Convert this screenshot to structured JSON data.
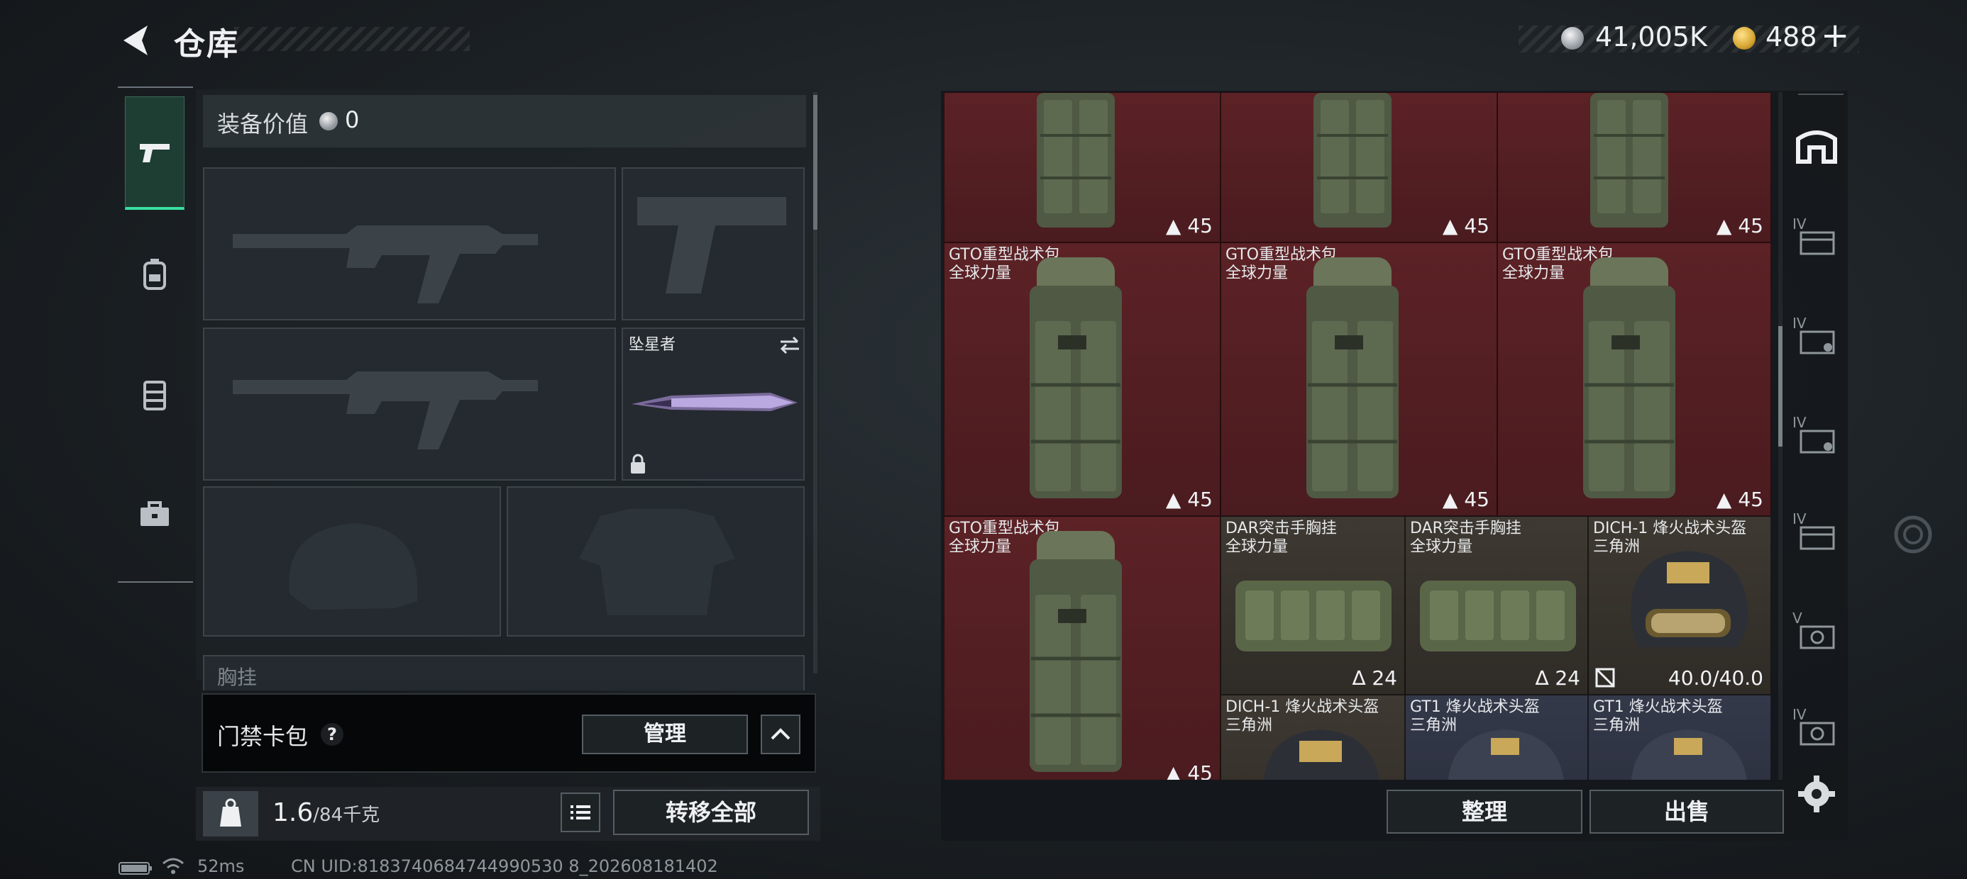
{
  "header": {
    "title": "仓库",
    "currency1": "41,005K",
    "currency2": "488",
    "plus_label": "+"
  },
  "equipment": {
    "value_label": "装备价值",
    "value": "0",
    "melee_name": "坠星者",
    "chest_label": "胸挂"
  },
  "card_bag": {
    "title": "门禁卡包",
    "help": "?",
    "manage_label": "管理"
  },
  "weight": {
    "current": "1.6",
    "max": "/84千克",
    "kg_icon_text": "KG",
    "transfer_label": "转移全部"
  },
  "status": {
    "ping": "52ms",
    "uid": "CN UID:8183740684744990530 8_202608181402"
  },
  "storage": {
    "items": [
      {
        "name": "",
        "sub": "",
        "count": "45",
        "count_icon": "bag-icon"
      },
      {
        "name": "",
        "sub": "",
        "count": "45",
        "count_icon": "bag-icon"
      },
      {
        "name": "",
        "sub": "",
        "count": "45",
        "count_icon": "bag-icon"
      },
      {
        "name": "GTO重型战术包",
        "sub": "全球力量",
        "count": "45",
        "count_icon": "bag-icon"
      },
      {
        "name": "GTO重型战术包",
        "sub": "全球力量",
        "count": "45",
        "count_icon": "bag-icon"
      },
      {
        "name": "GTO重型战术包",
        "sub": "全球力量",
        "count": "45",
        "count_icon": "bag-icon"
      },
      {
        "name": "GTO重型战术包",
        "sub": "全球力量",
        "count": "45",
        "count_icon": "bag-icon"
      },
      {
        "name": "DAR突击手胸挂",
        "sub": "全球力量",
        "count": "24",
        "count_icon": "vest-icon"
      },
      {
        "name": "DAR突击手胸挂",
        "sub": "全球力量",
        "count": "24",
        "count_icon": "vest-icon"
      },
      {
        "name": "DICH-1 烽火战术头盔",
        "sub": "三角洲",
        "count": "40.0/40.0",
        "count_icon": "durability-icon"
      },
      {
        "name": "DICH-1 烽火战术头盔",
        "sub": "三角洲",
        "count": "",
        "count_icon": ""
      },
      {
        "name": "GT1 烽火战术头盔",
        "sub": "三角洲",
        "count": "",
        "count_icon": ""
      },
      {
        "name": "GT1 烽火战术头盔",
        "sub": "三角洲",
        "count": "",
        "count_icon": ""
      }
    ],
    "sort_label": "整理",
    "sell_label": "出售"
  },
  "right_tabs": [
    "IV",
    "IV",
    "IV",
    "IV",
    "V",
    "IV"
  ],
  "colors": {
    "active_tab": "#39e0a0",
    "red_cell": "#4f1d21",
    "gold_cell": "#36322c",
    "blue_cell": "#2d3140"
  }
}
